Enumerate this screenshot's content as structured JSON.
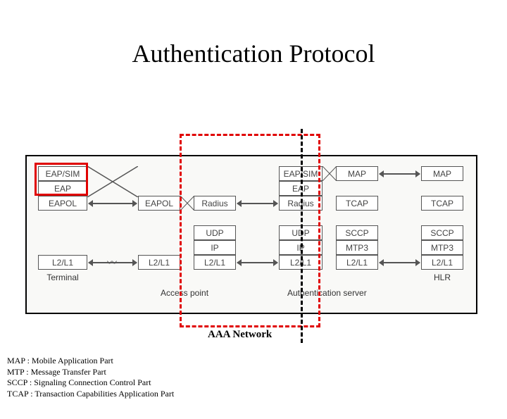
{
  "title": "Authentication Protocol",
  "aaa_label": "AAA Network",
  "nodes": {
    "terminal": {
      "label": "Terminal",
      "layers": [
        "EAP/SIM",
        "EAP",
        "EAPOL",
        "L2/L1"
      ]
    },
    "ap_left": {
      "layers": [
        "EAPOL",
        "L2/L1"
      ]
    },
    "ap_right": {
      "layers": [
        "Radius",
        "UDP",
        "IP",
        "L2/L1"
      ]
    },
    "ap_label": "Access point",
    "as_left": {
      "layers": [
        "EAP/SIM",
        "EAP",
        "Radius",
        "UDP",
        "IP",
        "L2/L1"
      ]
    },
    "as_right": {
      "layers": [
        "MAP",
        "TCAP",
        "SCCP",
        "MTP3",
        "L2/L1"
      ]
    },
    "as_label": "Authentication server",
    "hlr": {
      "label": "HLR",
      "layers": [
        "MAP",
        "TCAP",
        "SCCP",
        "MTP3",
        "L2/L1"
      ]
    }
  },
  "legend": [
    "MAP : Mobile Application Part",
    "MTP : Message Transfer Part",
    "SCCP : Signaling Connection Control Part",
    "TCAP : Transaction Capabilities Application Part"
  ]
}
